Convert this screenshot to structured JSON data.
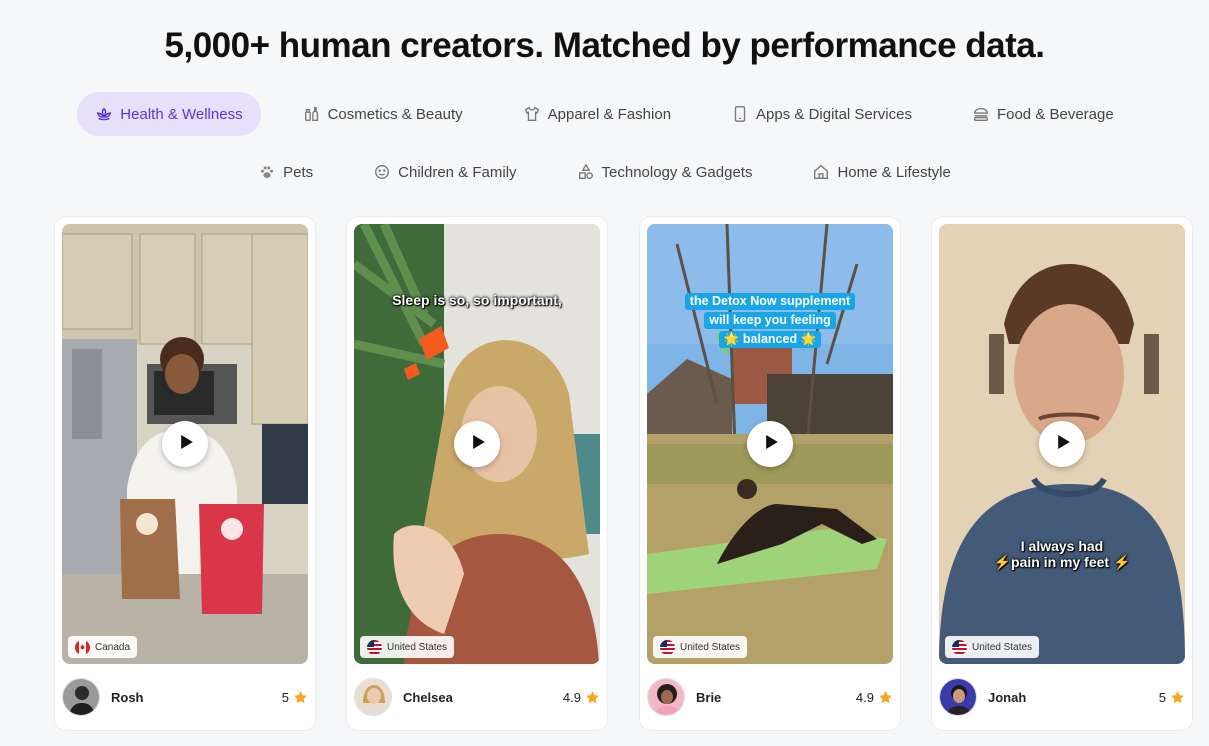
{
  "headline": "5,000+ human creators. Matched by performance data.",
  "categories_row1": [
    {
      "label": "Health & Wellness",
      "icon": "lotus-icon",
      "active": true
    },
    {
      "label": "Cosmetics & Beauty",
      "icon": "cosmetics-icon",
      "active": false
    },
    {
      "label": "Apparel & Fashion",
      "icon": "tshirt-icon",
      "active": false
    },
    {
      "label": "Apps & Digital Services",
      "icon": "smartphone-icon",
      "active": false
    },
    {
      "label": "Food & Beverage",
      "icon": "burger-icon",
      "active": false
    }
  ],
  "categories_row2": [
    {
      "label": "Pets",
      "icon": "paw-icon",
      "active": false
    },
    {
      "label": "Children & Family",
      "icon": "smiley-icon",
      "active": false
    },
    {
      "label": "Technology & Gadgets",
      "icon": "shapes-icon",
      "active": false
    },
    {
      "label": "Home & Lifestyle",
      "icon": "house-icon",
      "active": false
    }
  ],
  "creators": [
    {
      "name": "Rosh",
      "rating": "5",
      "country": "Canada",
      "caption": ""
    },
    {
      "name": "Chelsea",
      "rating": "4.9",
      "country": "United States",
      "caption": "Sleep is so, so important,"
    },
    {
      "name": "Brie",
      "rating": "4.9",
      "country": "United States",
      "caption_lines": [
        "the Detox Now supplement",
        "will keep you feeling",
        "🌟 balanced 🌟"
      ]
    },
    {
      "name": "Jonah",
      "rating": "5",
      "country": "United States",
      "caption_lines": [
        "I always had",
        "⚡pain in my feet ⚡"
      ]
    }
  ],
  "colors": {
    "accent": "#5b34d6",
    "accent_bg": "#e6e0fb",
    "star": "#f5a623"
  }
}
